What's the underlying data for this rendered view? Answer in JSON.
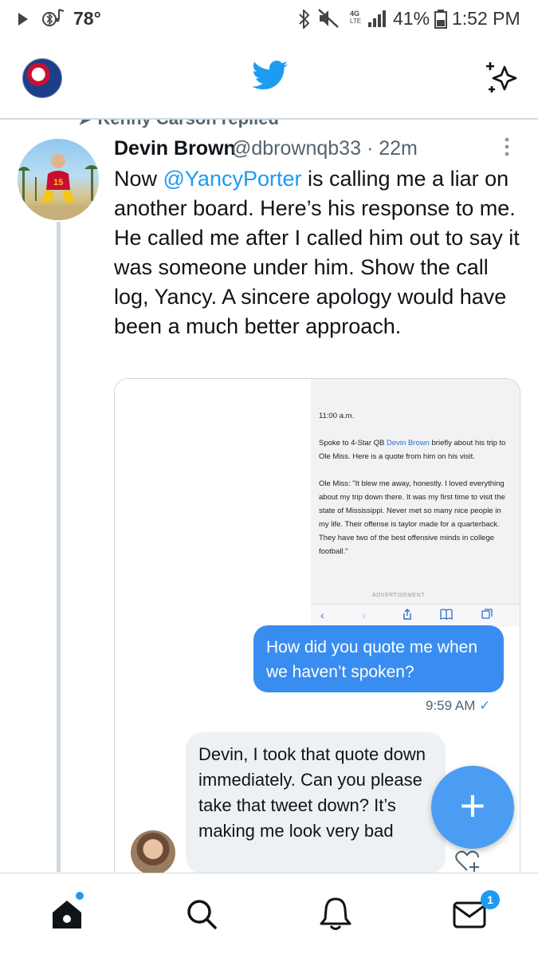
{
  "status_bar": {
    "temperature": "78°",
    "battery": "41%",
    "time": "1:52 PM"
  },
  "header": {
    "logo_icon": "twitter-bird-icon",
    "sparkle_icon": "sparkle-icon"
  },
  "tweet": {
    "replied_context": "Kenny Carson replied",
    "display_name": "Devin Brown",
    "handle": "@dbrownqb33",
    "separator": "·",
    "age": "22m",
    "text_before_mention": "Now ",
    "mention": "@YancyPorter",
    "text_after_mention": " is calling me a liar on another board. Here’s his response to me. He called me after I called him out to say it was someone under him. Show the call log, Yancy. A sincere apology would have been a much better approach."
  },
  "media": {
    "article": {
      "time": "11:00 a.m.",
      "para1_a": "Spoke to 4-Star QB ",
      "para1_link": "Devin Brown",
      "para1_b": " briefly about his trip to Ole Miss.  Here is a quote from him on his visit.",
      "para2": "Ole Miss: \"It blew me away, honestly.  I loved everything about my trip down there.  It was my first time to visit the state of Mississippi.  Never met so many nice people in my life.  Their offense is taylor made for a quarterback.  They have two of the best offensive minds in college football.\"",
      "ad_label": "ADVERTISEMENT"
    },
    "outgoing_message": "How did you quote me when we haven’t spoken?",
    "outgoing_time": "9:59 AM",
    "incoming_message": "Devin, I took that quote down immediately. Can you please take that tweet down? It’s making me look very bad"
  },
  "fab": {
    "label": "+"
  },
  "bottom_nav": {
    "messages_badge": "1"
  },
  "colors": {
    "accent": "#1d9bf0",
    "outgoing_bubble": "#3a8df0",
    "incoming_bubble": "#eef1f3"
  }
}
